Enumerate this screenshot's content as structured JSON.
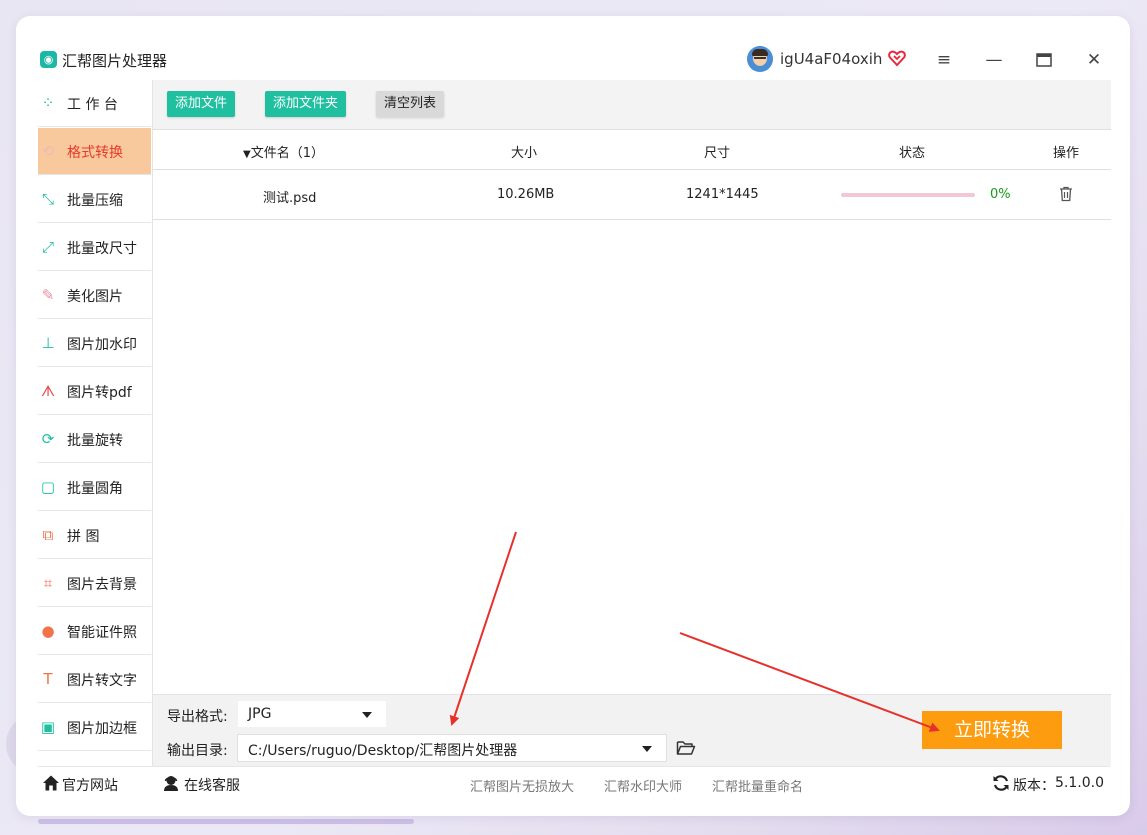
{
  "app": {
    "title": "汇帮图片处理器",
    "username": "igU4aF04oxih"
  },
  "window_controls": {
    "menu": "≡",
    "minimize": "—",
    "maximize": "▭",
    "close": "✕"
  },
  "sidebar": {
    "items": [
      {
        "label": "工 作 台",
        "icon": "grid-icon",
        "glyph": "⁘",
        "color": "#1fbfa0"
      },
      {
        "label": "格式转换",
        "icon": "convert-icon",
        "glyph": "⟲",
        "color": "#f3b7b7"
      },
      {
        "label": "批量压缩",
        "icon": "compress-icon",
        "glyph": "⤡",
        "color": "#1fbfa0"
      },
      {
        "label": "批量改尺寸",
        "icon": "resize-icon",
        "glyph": "⤢",
        "color": "#1fbfa0"
      },
      {
        "label": "美化图片",
        "icon": "beautify-icon",
        "glyph": "✎",
        "color": "#f08aa0"
      },
      {
        "label": "图片加水印",
        "icon": "watermark-icon",
        "glyph": "⊥",
        "color": "#1fbfa0"
      },
      {
        "label": "图片转pdf",
        "icon": "pdf-icon",
        "glyph": "ᗑ",
        "color": "#e85050"
      },
      {
        "label": "批量旋转",
        "icon": "rotate-icon",
        "glyph": "⟳",
        "color": "#1fbfa0"
      },
      {
        "label": "批量圆角",
        "icon": "rounded-corner-icon",
        "glyph": "▢",
        "color": "#1fbfa0"
      },
      {
        "label": "拼    图",
        "icon": "puzzle-icon",
        "glyph": "⧉",
        "color": "#f0734a"
      },
      {
        "label": "图片去背景",
        "icon": "crop-icon",
        "glyph": "⌗",
        "color": "#f0734a"
      },
      {
        "label": "智能证件照",
        "icon": "id-photo-icon",
        "glyph": "●",
        "color": "#f0734a"
      },
      {
        "label": "图片转文字",
        "icon": "text-icon",
        "glyph": "T",
        "color": "#f0734a"
      },
      {
        "label": "图片加边框",
        "icon": "frame-icon",
        "glyph": "▣",
        "color": "#1fbfa0"
      }
    ],
    "active_index": 1
  },
  "toolbar": {
    "add_file": "添加文件",
    "add_folder": "添加文件夹",
    "clear_list": "清空列表"
  },
  "table": {
    "headers": {
      "filename": "文件名（1）",
      "size": "大小",
      "dimensions": "尺寸",
      "status": "状态",
      "actions": "操作"
    },
    "rows": [
      {
        "filename": "测试.psd",
        "size": "10.26MB",
        "dimensions": "1241*1445",
        "progress_text": "0%",
        "progress": 0
      }
    ]
  },
  "export": {
    "format_label": "导出格式:",
    "format_value": "JPG",
    "dir_label": "输出目录:",
    "dir_value": "C:/Users/ruguo/Desktop/汇帮图片处理器"
  },
  "convert_button": "立即转换",
  "statusbar": {
    "website": "官方网站",
    "support": "在线客服",
    "links": [
      "汇帮图片无损放大",
      "汇帮水印大师",
      "汇帮批量重命名"
    ],
    "version_label": "版本：",
    "version_value": "5.1.0.0"
  },
  "colors": {
    "accent": "#1fbfa0",
    "active_nav": "#f8c99c",
    "convert": "#fd9c0f",
    "annotation_arrow": "#e8302a"
  }
}
